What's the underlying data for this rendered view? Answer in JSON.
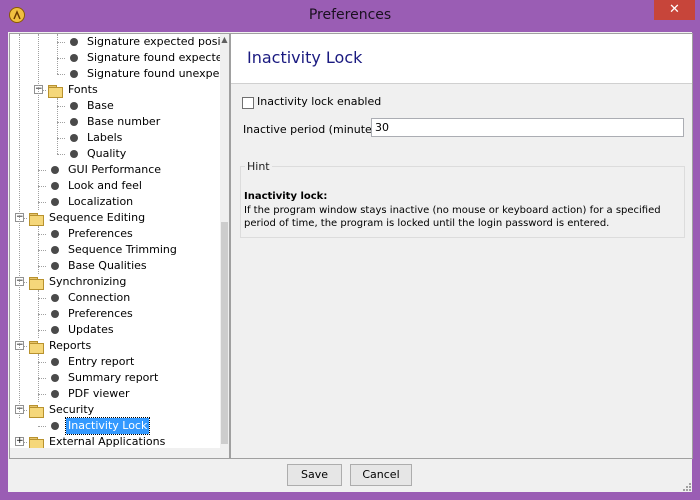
{
  "window": {
    "title": "Preferences",
    "close_glyph": "✕",
    "app_icon": "lambda-icon",
    "accent_color": "#9a5db4"
  },
  "tree": {
    "items": [
      {
        "label": "Signature expected position",
        "level": 3,
        "kind": "leaf"
      },
      {
        "label": "Signature found expected",
        "level": 3,
        "kind": "leaf"
      },
      {
        "label": "Signature found unexpected",
        "level": 3,
        "kind": "leaf"
      },
      {
        "label": "Fonts",
        "level": 2,
        "kind": "folder",
        "expanded": true
      },
      {
        "label": "Base",
        "level": 3,
        "kind": "leaf"
      },
      {
        "label": "Base number",
        "level": 3,
        "kind": "leaf"
      },
      {
        "label": "Labels",
        "level": 3,
        "kind": "leaf"
      },
      {
        "label": "Quality",
        "level": 3,
        "kind": "leaf"
      },
      {
        "label": "GUI Performance",
        "level": 2,
        "kind": "leaf"
      },
      {
        "label": "Look and feel",
        "level": 2,
        "kind": "leaf"
      },
      {
        "label": "Localization",
        "level": 2,
        "kind": "leaf"
      },
      {
        "label": "Sequence Editing",
        "level": 1,
        "kind": "folder",
        "expanded": true
      },
      {
        "label": "Preferences",
        "level": 2,
        "kind": "leaf"
      },
      {
        "label": "Sequence Trimming",
        "level": 2,
        "kind": "leaf"
      },
      {
        "label": "Base Qualities",
        "level": 2,
        "kind": "leaf"
      },
      {
        "label": "Synchronizing",
        "level": 1,
        "kind": "folder",
        "expanded": true
      },
      {
        "label": "Connection",
        "level": 2,
        "kind": "leaf"
      },
      {
        "label": "Preferences",
        "level": 2,
        "kind": "leaf"
      },
      {
        "label": "Updates",
        "level": 2,
        "kind": "leaf"
      },
      {
        "label": "Reports",
        "level": 1,
        "kind": "folder",
        "expanded": true
      },
      {
        "label": "Entry report",
        "level": 2,
        "kind": "leaf"
      },
      {
        "label": "Summary report",
        "level": 2,
        "kind": "leaf"
      },
      {
        "label": "PDF viewer",
        "level": 2,
        "kind": "leaf"
      },
      {
        "label": "Security",
        "level": 1,
        "kind": "folder",
        "expanded": true
      },
      {
        "label": "Inactivity Lock",
        "level": 2,
        "kind": "leaf",
        "selected": true
      },
      {
        "label": "External Applications",
        "level": 1,
        "kind": "folder",
        "expanded": false
      }
    ]
  },
  "main": {
    "title": "Inactivity Lock",
    "checkbox_label": "Inactivity lock enabled",
    "checkbox_checked": false,
    "period_label": "Inactive period (minutes):",
    "period_value": "30",
    "hint": {
      "title": "Hint",
      "heading": "Inactivity lock:",
      "body": "If the program window stays inactive (no mouse or keyboard action) for a specified period of time, the program is locked until the login password is entered."
    }
  },
  "buttons": {
    "save": "Save",
    "cancel": "Cancel"
  }
}
